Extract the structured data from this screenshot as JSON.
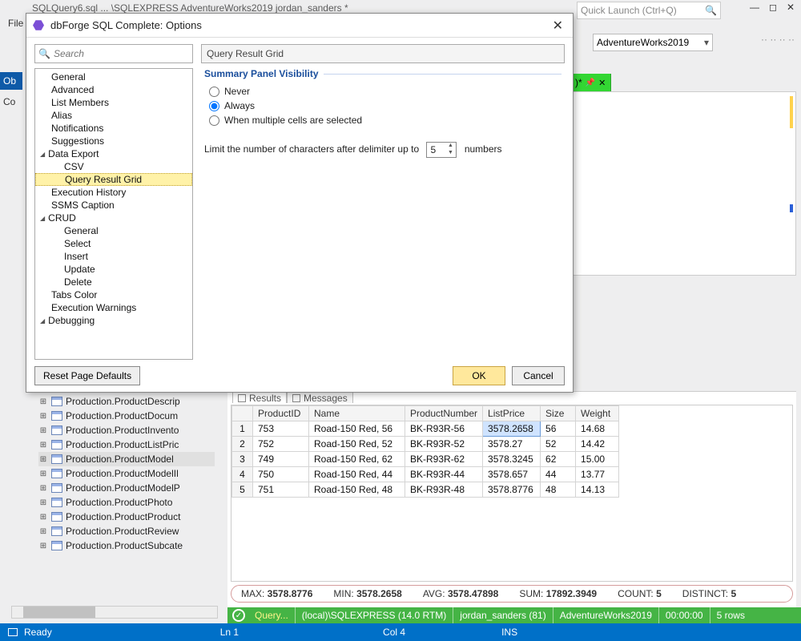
{
  "main_window": {
    "title_fragment": "SQLQuery6.sql ... \\SQLEXPRESS AdventureWorks2019 jordan_sanders *",
    "quick_launch_placeholder": "Quick Launch (Ctrl+Q)",
    "menu_visible": "File",
    "db_combo": "AdventureWorks2019",
    "doc_tab_suffix": ")*",
    "left_stub1": "Ob",
    "left_stub2": "Co"
  },
  "dialog": {
    "title": "dbForge SQL Complete: Options",
    "search_placeholder": "Search",
    "breadcrumb": "Query Result Grid",
    "tree": {
      "items": [
        "General",
        "Advanced",
        "List Members",
        "Alias",
        "Notifications",
        "Suggestions"
      ],
      "data_export": {
        "label": "Data Export",
        "children": [
          "CSV",
          "Query Result Grid"
        ]
      },
      "after_export": [
        "Execution History",
        "SSMS Caption"
      ],
      "crud": {
        "label": "CRUD",
        "children": [
          "General",
          "Select",
          "Insert",
          "Update",
          "Delete"
        ]
      },
      "tail": [
        "Tabs Color",
        "Execution Warnings",
        "Debugging"
      ]
    },
    "panel": {
      "section": "Summary Panel Visibility",
      "radios": {
        "never": "Never",
        "always": "Always",
        "multi": "When multiple cells are selected"
      },
      "selected": "always",
      "limit_prefix": "Limit the number of characters after delimiter up to",
      "limit_value": "5",
      "limit_suffix": "numbers"
    },
    "buttons": {
      "reset": "Reset Page Defaults",
      "ok": "OK",
      "cancel": "Cancel"
    }
  },
  "object_explorer": {
    "rows": [
      "Production.ProductDescrip",
      "Production.ProductDocum",
      "Production.ProductInvento",
      "Production.ProductListPric",
      "Production.ProductModel",
      "Production.ProductModelIl",
      "Production.ProductModelP",
      "Production.ProductPhoto",
      "Production.ProductProduct",
      "Production.ProductReview",
      "Production.ProductSubcate"
    ],
    "highlight_index": 4
  },
  "results": {
    "tabs": {
      "results": "Results",
      "messages": "Messages"
    },
    "columns": [
      "ProductID",
      "Name",
      "ProductNumber",
      "ListPrice",
      "Size",
      "Weight"
    ],
    "rows": [
      {
        "n": "1",
        "ProductID": "753",
        "Name": "Road-150 Red, 56",
        "ProductNumber": "BK-R93R-56",
        "ListPrice": "3578.2658",
        "Size": "56",
        "Weight": "14.68"
      },
      {
        "n": "2",
        "ProductID": "752",
        "Name": "Road-150 Red, 52",
        "ProductNumber": "BK-R93R-52",
        "ListPrice": "3578.27",
        "Size": "52",
        "Weight": "14.42"
      },
      {
        "n": "3",
        "ProductID": "749",
        "Name": "Road-150 Red, 62",
        "ProductNumber": "BK-R93R-62",
        "ListPrice": "3578.3245",
        "Size": "62",
        "Weight": "15.00"
      },
      {
        "n": "4",
        "ProductID": "750",
        "Name": "Road-150 Red, 44",
        "ProductNumber": "BK-R93R-44",
        "ListPrice": "3578.657",
        "Size": "44",
        "Weight": "13.77"
      },
      {
        "n": "5",
        "ProductID": "751",
        "Name": "Road-150 Red, 48",
        "ProductNumber": "BK-R93R-48",
        "ListPrice": "3578.8776",
        "Size": "48",
        "Weight": "14.13"
      }
    ],
    "selected_cell": {
      "row": 0,
      "col": "ListPrice"
    },
    "summary": {
      "MAX": "3578.8776",
      "MIN": "3578.2658",
      "AVG": "3578.47898",
      "SUM": "17892.3949",
      "COUNT": "5",
      "DISTINCT": "5"
    }
  },
  "green_status": {
    "query": "Query...",
    "server": "(local)\\SQLEXPRESS (14.0 RTM)",
    "user": "jordan_sanders (81)",
    "db": "AdventureWorks2019",
    "time": "00:00:00",
    "rows": "5 rows"
  },
  "blue_status": {
    "ready": "Ready",
    "ln": "Ln 1",
    "col": "Col 4",
    "ins": "INS"
  }
}
